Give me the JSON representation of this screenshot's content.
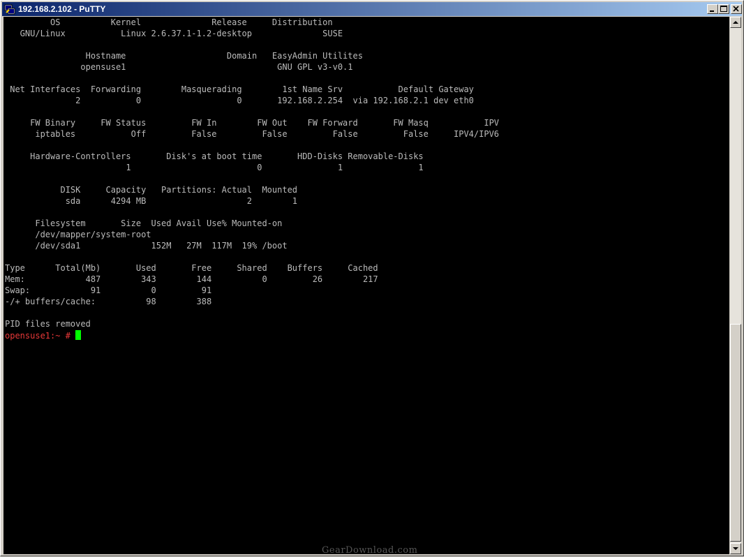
{
  "window": {
    "title": "192.168.2.102 - PuTTY"
  },
  "icons": {
    "app": "putty-icon",
    "minimize": "minimize-icon",
    "maximize": "maximize-icon",
    "close": "close-icon"
  },
  "colors": {
    "terminal_bg": "#000000",
    "text": "#bbbbbb",
    "prompt": "#e83838",
    "cursor": "#00ff00"
  },
  "terminal": {
    "lines": [
      "         OS          Kernel              Release     Distribution",
      "   GNU/Linux           Linux 2.6.37.1-1.2-desktop              SUSE",
      "",
      "                Hostname                    Domain   EasyAdmin Utilites",
      "               opensuse1                              GNU GPL v3-v0.1",
      "",
      " Net Interfaces  Forwarding        Masquerading        1st Name Srv           Default Gateway",
      "              2           0                   0       192.168.2.254  via 192.168.2.1 dev eth0",
      "",
      "     FW Binary     FW Status         FW In        FW Out    FW Forward       FW Masq           IPV",
      "      iptables           Off         False         False         False         False     IPV4/IPV6",
      "",
      "     Hardware-Controllers       Disk's at boot time       HDD-Disks Removable-Disks",
      "                        1                         0               1               1",
      "",
      "           DISK     Capacity   Partitions: Actual  Mounted",
      "            sda      4294 MB                    2        1",
      "",
      "      Filesystem       Size  Used Avail Use% Mounted-on",
      "      /dev/mapper/system-root",
      "      /dev/sda1              152M   27M  117M  19% /boot",
      "",
      "Type      Total(Mb)       Used       Free     Shared    Buffers     Cached",
      "Mem:            487        343        144          0         26        217",
      "Swap:            91          0         91",
      "-/+ buffers/cache:          98        388",
      "",
      "PID files removed"
    ],
    "prompt": "opensuse1:~ # "
  },
  "watermark": "GearDownload.com"
}
